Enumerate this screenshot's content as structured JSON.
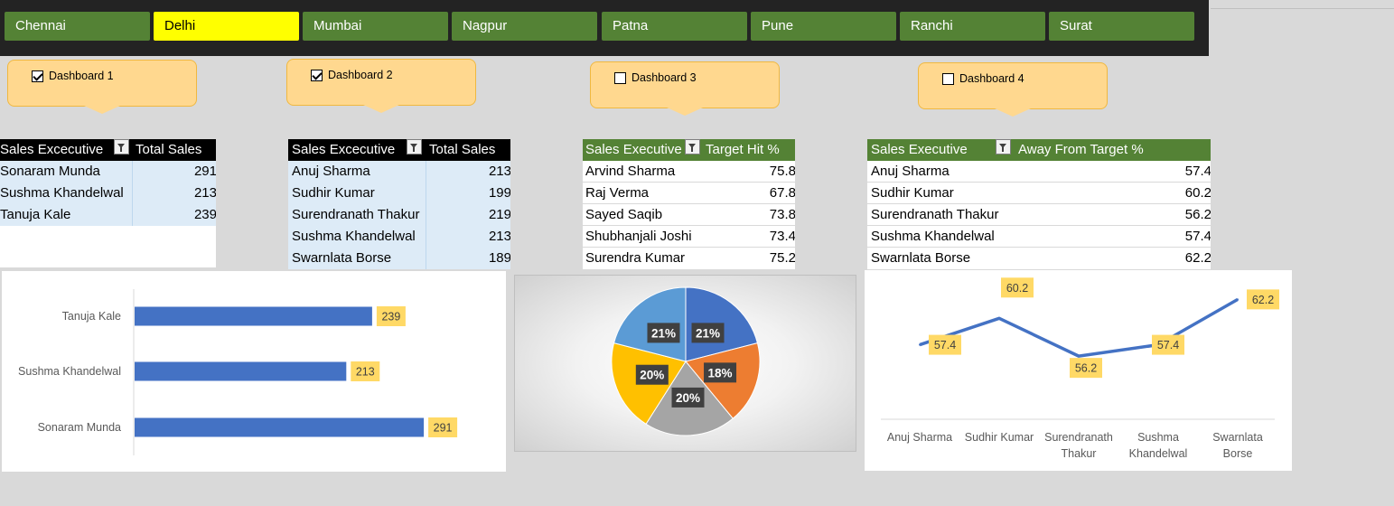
{
  "slicer": {
    "items": [
      "Chennai",
      "Delhi",
      "Mumbai",
      "Nagpur",
      "Patna",
      "Pune",
      "Ranchi",
      "Surat"
    ],
    "selected": "Delhi"
  },
  "dashboards": [
    {
      "label": "Dashboard 1",
      "checked": true
    },
    {
      "label": "Dashboard 2",
      "checked": true
    },
    {
      "label": "Dashboard 3",
      "checked": false
    },
    {
      "label": "Dashboard 4",
      "checked": false
    }
  ],
  "table1": {
    "headers": [
      "Sales Excecutive",
      "Total Sales"
    ],
    "rows": [
      [
        "Sonaram Munda",
        "291"
      ],
      [
        "Sushma Khandelwal",
        "213"
      ],
      [
        "Tanuja Kale",
        "239"
      ]
    ]
  },
  "table2": {
    "headers": [
      "Sales Excecutive",
      "Total Sales"
    ],
    "rows": [
      [
        "Anuj Sharma",
        "213"
      ],
      [
        "Sudhir Kumar",
        "199"
      ],
      [
        "Surendranath Thakur",
        "219"
      ],
      [
        "Sushma Khandelwal",
        "213"
      ],
      [
        "Swarnlata Borse",
        "189"
      ]
    ]
  },
  "table3": {
    "headers": [
      "Sales Executive",
      "Target Hit %"
    ],
    "rows": [
      [
        "Arvind Sharma",
        "75.8"
      ],
      [
        "Raj Verma",
        "67.8"
      ],
      [
        "Sayed Saqib",
        "73.8"
      ],
      [
        "Shubhanjali Joshi",
        "73.4"
      ],
      [
        "Surendra Kumar",
        "75.2"
      ]
    ]
  },
  "table4": {
    "headers": [
      "Sales Executive",
      "Away From Target %"
    ],
    "rows": [
      [
        "Anuj Sharma",
        "57.4"
      ],
      [
        "Sudhir Kumar",
        "60.2"
      ],
      [
        "Surendranath Thakur",
        "56.2"
      ],
      [
        "Sushma Khandelwal",
        "57.4"
      ],
      [
        "Swarnlata Borse",
        "62.2"
      ]
    ]
  },
  "colors": {
    "slicer_green": "#548235",
    "slicer_selected": "#ffff00",
    "header_black": "#000000",
    "header_green": "#548235",
    "table_blue": "#ddebf7",
    "bar_blue": "#4472c4",
    "label_gold": "#ffd966"
  },
  "chart_data": [
    {
      "type": "bar",
      "orientation": "horizontal",
      "categories": [
        "Tanuja Kale",
        "Sushma Khandelwal",
        "Sonaram Munda"
      ],
      "values": [
        239,
        213,
        291
      ],
      "xlim": [
        0,
        300
      ],
      "title": "",
      "xlabel": "",
      "ylabel": "",
      "bar_color": "#4472c4"
    },
    {
      "type": "pie",
      "labels": [
        "21%",
        "18%",
        "20%",
        "20%",
        "21%"
      ],
      "values": [
        21,
        18,
        20,
        20,
        21
      ],
      "colors": [
        "#4472c4",
        "#ed7d31",
        "#a5a5a5",
        "#ffc000",
        "#5b9bd5"
      ],
      "title": ""
    },
    {
      "type": "line",
      "categories": [
        "Anuj Sharma",
        "Sudhir Kumar",
        "Surendranath Thakur",
        "Sushma Khandelwal",
        "Swarnlata Borse"
      ],
      "values": [
        57.4,
        60.2,
        56.2,
        57.4,
        62.2
      ],
      "ylim": [
        50,
        63
      ],
      "title": "",
      "xlabel": "",
      "ylabel": "",
      "line_color": "#4472c4"
    }
  ]
}
